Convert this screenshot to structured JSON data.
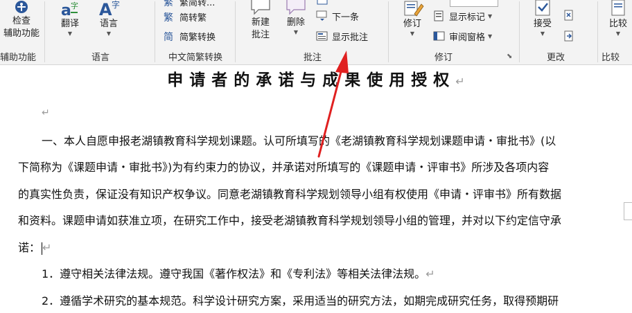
{
  "ribbon": {
    "groups": {
      "accessibility": {
        "check_label_line1": "检查",
        "check_label_line2": "辅助功能",
        "group_label": "辅助功能"
      },
      "language": {
        "translate_label": "翻译",
        "language_label": "语言",
        "group_label": "语言"
      },
      "chinese_conversion": {
        "top_label": "繁简转...",
        "simplify_label": "简转繁",
        "convert_label": "简繁转换",
        "group_label": "中文简繁转换"
      },
      "comments": {
        "new_comment_line1": "新建",
        "new_comment_line2": "批注",
        "delete_label": "删除",
        "next_label": "下一条",
        "show_comments_label": "显示批注",
        "group_label": "批注"
      },
      "tracking": {
        "track_label": "修订",
        "show_markup_label": "显示标记",
        "review_pane_label": "审阅窗格",
        "group_label": "修订"
      },
      "changes": {
        "accept_label": "接受",
        "group_label": "更改"
      },
      "compare": {
        "compare_label": "比较",
        "group_label": "比较"
      }
    },
    "colors": {
      "accent": "#2b579a",
      "arrow": "#e02020"
    }
  },
  "document": {
    "title": "申请者的承诺与成果使用授权",
    "para_mark": "↵",
    "lines": [
      "一、本人自愿申报老湖镇教育科学规划课题。认可所填写的《老湖镇教育科学规划课题申请・审批书》(以",
      "下简称为《课题申请・审批书》)为有约束力的协议，并承诺对所填写的《课题申请・评审书》所涉及各项内容",
      "的真实性负责，保证没有知识产权争议。同意老湖镇教育科学规划领导小组有权使用《申请・评审书》所有数据",
      "和资料。课题申请如获准立项，在研究工作中，接受老湖镇教育科学规划领导小组的管理，并对以下约定信守承",
      "诺："
    ],
    "item1": "1．遵守相关法律法规。遵守我国《著作权法》和《专利法》等相关法律法规。",
    "item2": "2．遵循学术研究的基本规范。科学设计研究方案，采用适当的研究方法，如期完成研究任务，取得预期研"
  }
}
